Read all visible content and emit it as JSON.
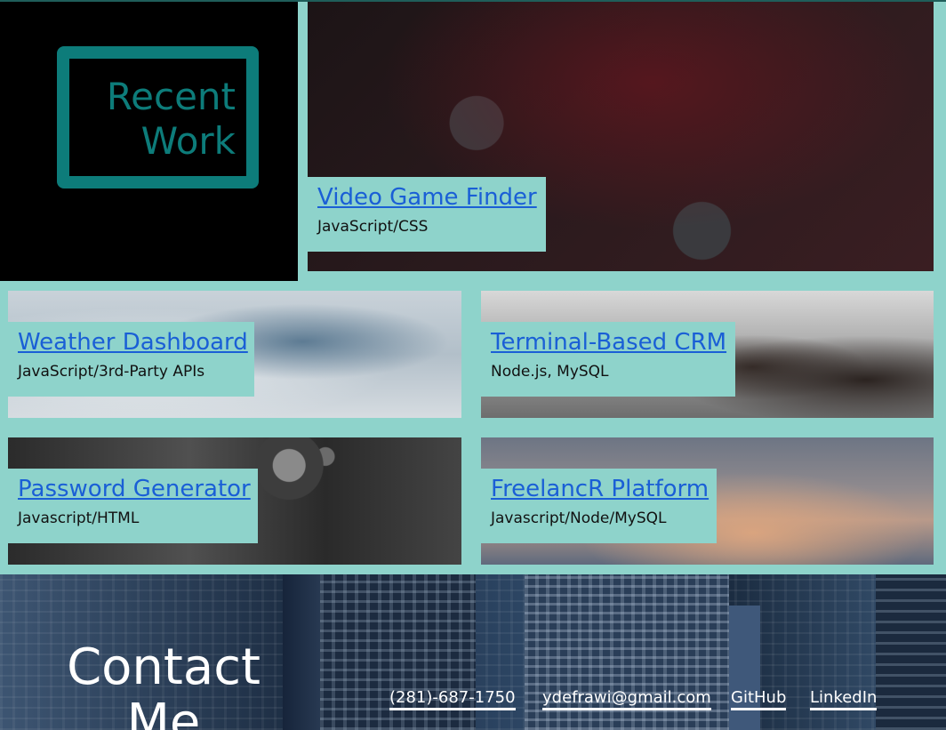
{
  "recent_work": {
    "title": "Recent Work"
  },
  "projects": [
    {
      "title": "Video Game Finder",
      "tech": "JavaScript/CSS",
      "image": "game-controller-photo"
    },
    {
      "title": "Weather Dashboard",
      "tech": "JavaScript/3rd-Party APIs",
      "image": "clouds-photo"
    },
    {
      "title": "Terminal-Based CRM",
      "tech": "Node.js, MySQL",
      "image": "office-meeting-photo"
    },
    {
      "title": "Password Generator",
      "tech": "Javascript/HTML",
      "image": "vault-safe-photo"
    },
    {
      "title": "FreelancR Platform",
      "tech": "Javascript/Node/MySQL",
      "image": "sunset-clouds-photo"
    }
  ],
  "contact": {
    "title": "Contact Me",
    "links": [
      {
        "label": "(281)-687-1750"
      },
      {
        "label": "ydefrawi@gmail.com"
      },
      {
        "label": "GitHub"
      },
      {
        "label": "LinkedIn"
      }
    ]
  },
  "colors": {
    "accent_teal": "#0d7c7a",
    "card_bg": "#8ed3cb",
    "link_blue": "#1a5fd6"
  }
}
